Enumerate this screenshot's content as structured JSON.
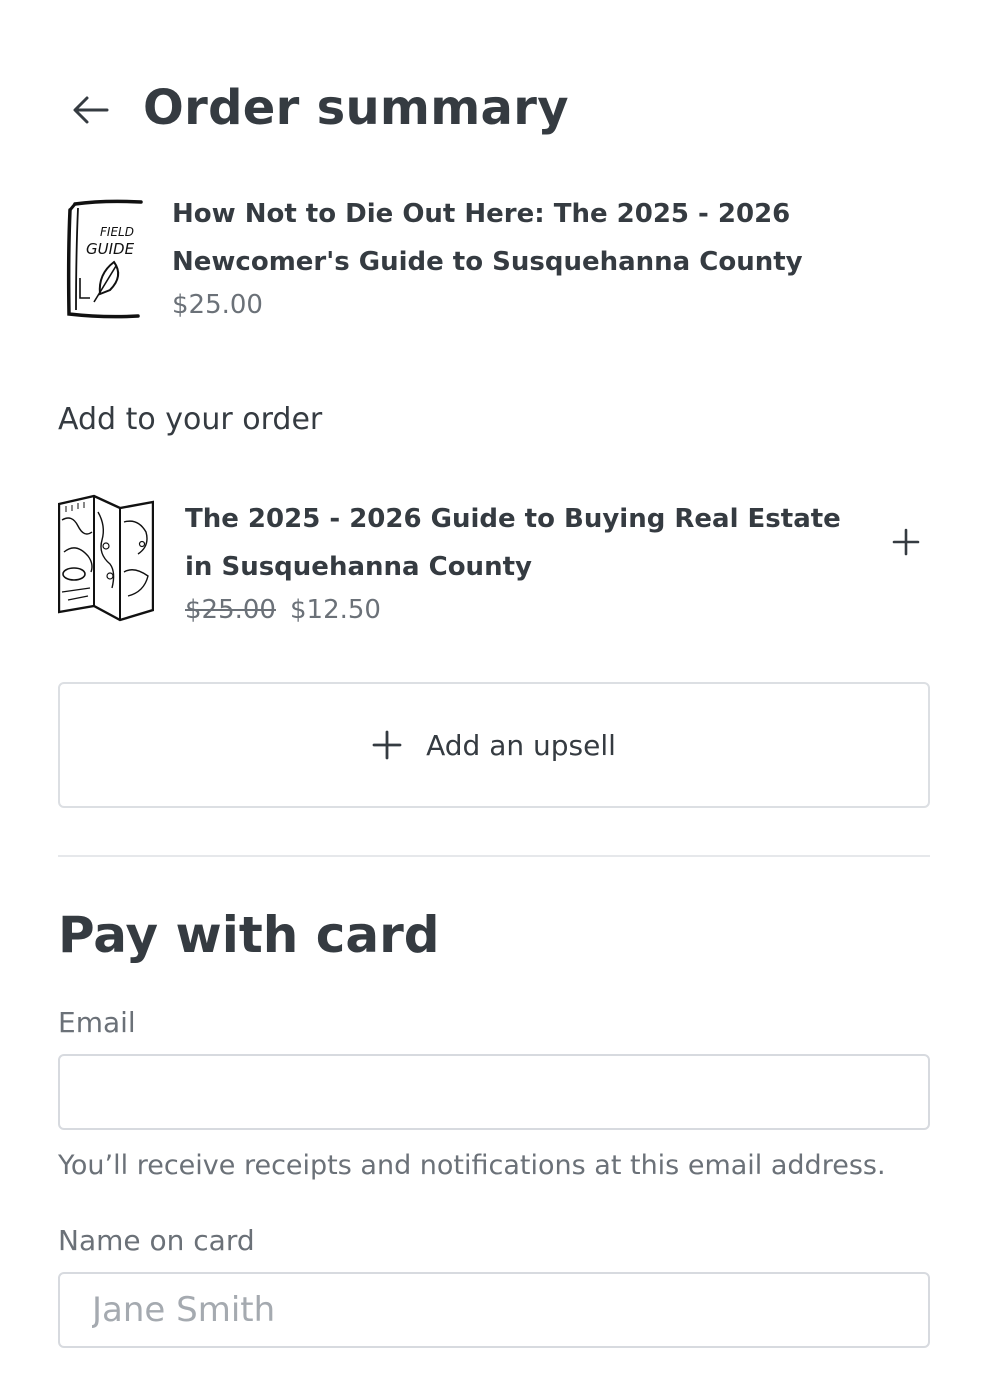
{
  "header": {
    "title": "Order summary"
  },
  "order_item": {
    "name": "How Not to Die Out Here: The 2025 - 2026 Newcomer's Guide to Susquehanna County",
    "price": "$25.00",
    "thumb_text_line1": "FIELD",
    "thumb_text_line2": "GUIDE"
  },
  "upsell_section": {
    "label": "Add to your order",
    "item": {
      "name": "The 2025 - 2026 Guide to Buying Real Estate in Susquehanna County",
      "original_price": "$25.00",
      "sale_price": "$12.50"
    },
    "add_upsell_label": "Add an upsell"
  },
  "payment": {
    "title": "Pay with card",
    "email": {
      "label": "Email",
      "value": "",
      "placeholder": "",
      "help": "You’ll receive receipts and notifications at this email address."
    },
    "name_on_card": {
      "label": "Name on card",
      "value": "",
      "placeholder": "Jane Smith"
    }
  }
}
